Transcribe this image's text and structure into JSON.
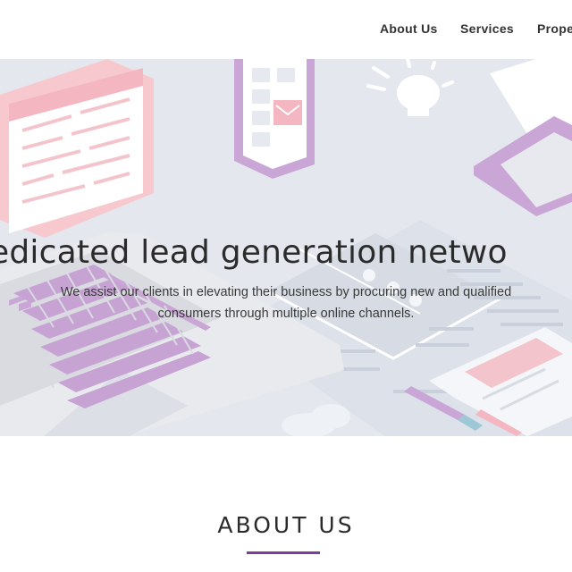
{
  "nav": {
    "items": [
      {
        "label": "About Us"
      },
      {
        "label": "Services"
      },
      {
        "label": "Prope"
      }
    ]
  },
  "hero": {
    "title": "edicated lead generation netwo",
    "subtitle_line1": "We assist our clients in elevating their business by procuring new and qualified",
    "subtitle_line2": "consumers through multiple online channels."
  },
  "about": {
    "heading": "ABOUT US"
  },
  "colors": {
    "accent": "#7b3d9e",
    "illustration_purple": "#c9a6d6",
    "illustration_pink": "#f4c4cc",
    "hero_background": "#e4e8ee"
  }
}
